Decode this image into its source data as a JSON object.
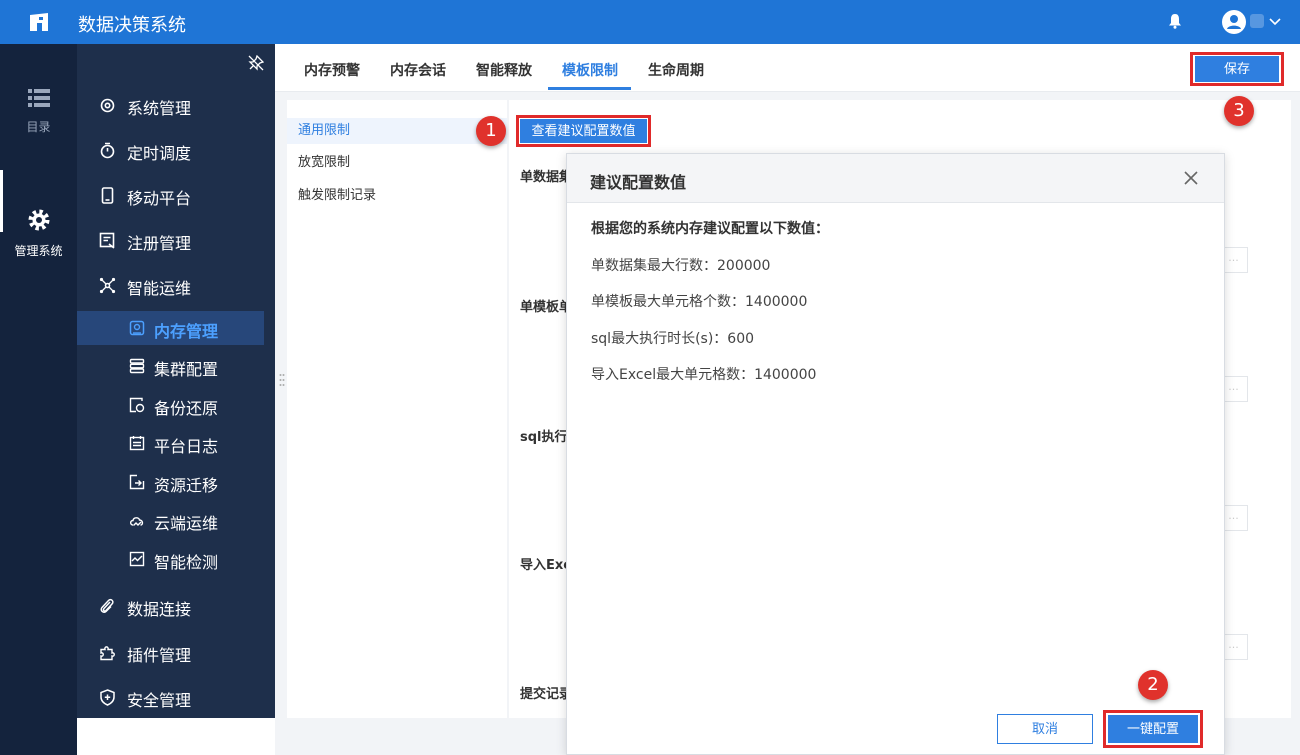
{
  "app": {
    "title": "数据决策系统"
  },
  "rail": {
    "catalog_label": "目录",
    "admin_label": "管理系统"
  },
  "sidebar": {
    "items": [
      {
        "label": "系统管理",
        "icon": "gear-icon"
      },
      {
        "label": "定时调度",
        "icon": "timer-icon"
      },
      {
        "label": "移动平台",
        "icon": "mobile-icon"
      },
      {
        "label": "注册管理",
        "icon": "register-icon"
      },
      {
        "label": "智能运维",
        "icon": "network-icon"
      }
    ],
    "subitems": [
      {
        "label": "内存管理",
        "icon": "memory-icon",
        "active": true
      },
      {
        "label": "集群配置",
        "icon": "cluster-icon"
      },
      {
        "label": "备份还原",
        "icon": "backup-icon"
      },
      {
        "label": "平台日志",
        "icon": "log-icon"
      },
      {
        "label": "资源迁移",
        "icon": "migrate-icon"
      },
      {
        "label": "云端运维",
        "icon": "cloud-icon"
      },
      {
        "label": "智能检测",
        "icon": "monitor-icon"
      }
    ],
    "bottom_items": [
      {
        "label": "数据连接",
        "icon": "paperclip-icon"
      },
      {
        "label": "插件管理",
        "icon": "puzzle-icon"
      },
      {
        "label": "安全管理",
        "icon": "shield-icon"
      }
    ]
  },
  "tabs": [
    "内存预警",
    "内存会话",
    "智能释放",
    "模板限制",
    "生命周期"
  ],
  "active_tab": "模板限制",
  "toolbar": {
    "save_label": "保存"
  },
  "left_menu": [
    "通用限制",
    "放宽限制",
    "触发限制记录"
  ],
  "main": {
    "view_button": "查看建议配置数值",
    "field_labels": [
      "单数据集",
      "单模板单",
      "sql执行",
      "导入Exce",
      "提交记录"
    ],
    "ellipsis": "..."
  },
  "dialog": {
    "title": "建议配置数值",
    "subtitle": "根据您的系统内存建议配置以下数值：",
    "lines": [
      "单数据集最大行数：200000",
      "单模板最大单元格个数：1400000",
      "sql最大执行时长(s)：600",
      "导入Excel最大单元格数：1400000"
    ],
    "cancel_label": "取消",
    "apply_label": "一键配置"
  },
  "callouts": [
    "1",
    "2",
    "3"
  ],
  "colors": {
    "accent": "#2f7fe0",
    "topbar": "#1f75d6",
    "sidebar": "#1e2f4b",
    "rail": "#14233d",
    "highlight": "#e02a2a"
  }
}
